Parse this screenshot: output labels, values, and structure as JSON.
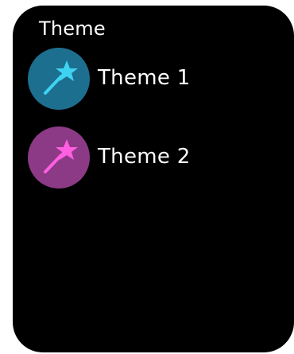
{
  "screen": {
    "title": "Theme"
  },
  "themes": [
    {
      "label": "Theme 1",
      "icon": "magic-wand-icon",
      "circle_color": "#1d6f8f",
      "wand_color": "#3fd3f2"
    },
    {
      "label": "Theme 2",
      "icon": "magic-wand-icon",
      "circle_color": "#8c3a86",
      "wand_color": "#ff5fe0"
    }
  ]
}
